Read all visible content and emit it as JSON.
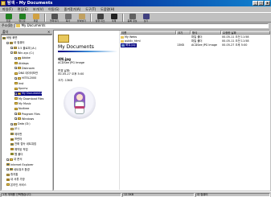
{
  "window": {
    "title": "탐색 - My Documents",
    "controls": [
      "_",
      "□",
      "x"
    ]
  },
  "menu": [
    "파일(F)",
    "편집(E)",
    "보기(V)",
    "이동(G)",
    "즐겨찾기(A)",
    "도구(T)",
    "도움말(H)"
  ],
  "toolbar": [
    {
      "label": "뒤로",
      "icon": "back-arrow-icon",
      "color": "#208020"
    },
    {
      "label": "앞으로",
      "icon": "forward-arrow-icon",
      "color": "#208020"
    },
    {
      "label": "위로",
      "icon": "up-folder-icon",
      "color": "#d0a040"
    },
    {
      "label": "잘라내기",
      "icon": "cut-icon",
      "color": "#505050"
    },
    {
      "label": "복사",
      "icon": "copy-icon",
      "color": "#707070"
    },
    {
      "label": "붙여넣기",
      "icon": "paste-icon",
      "color": "#c0a060"
    },
    {
      "label": "실행 취소",
      "icon": "undo-icon",
      "color": "#404040"
    },
    {
      "label": "삭제",
      "icon": "delete-icon",
      "color": "#202020"
    },
    {
      "label": "등록 정보",
      "icon": "properties-icon",
      "color": "#606060"
    },
    {
      "label": "보기",
      "icon": "views-icon",
      "color": "#404080"
    }
  ],
  "address": {
    "label": "주소(D)",
    "value": "My Documents"
  },
  "tree_pane": {
    "title": "폴더"
  },
  "tree": [
    {
      "label": "바탕 화면",
      "level": 0,
      "exp": "",
      "icon": "desktop"
    },
    {
      "label": "내 컴퓨터",
      "level": 1,
      "exp": "-",
      "icon": "computer"
    },
    {
      "label": "3.5 플로피 (A:)",
      "level": 2,
      "exp": "+",
      "icon": "drive"
    },
    {
      "label": "Win-sys (C:)",
      "level": 2,
      "exp": "-",
      "icon": "drive"
    },
    {
      "label": "Adobe",
      "level": 3,
      "exp": "+",
      "icon": "folder"
    },
    {
      "label": "Atidaps",
      "level": 3,
      "exp": "",
      "icon": "folder"
    },
    {
      "label": "Diskroom",
      "level": 3,
      "exp": "+",
      "icon": "folder"
    },
    {
      "label": "DNS 데이터보관",
      "level": 3,
      "exp": "",
      "icon": "folder"
    },
    {
      "label": "HITEL2000",
      "level": 3,
      "exp": "+",
      "icon": "folder"
    },
    {
      "label": "Inst",
      "level": 3,
      "exp": "",
      "icon": "folder"
    },
    {
      "label": "Kpcmv",
      "level": 3,
      "exp": "",
      "icon": "folder"
    },
    {
      "label": "My Documents",
      "level": 3,
      "exp": "+",
      "icon": "folder",
      "selected": true
    },
    {
      "label": "My Download Files",
      "level": 3,
      "exp": "",
      "icon": "folder"
    },
    {
      "label": "My Music",
      "level": 3,
      "exp": "",
      "icon": "folder"
    },
    {
      "label": "Ncdtree",
      "level": 3,
      "exp": "",
      "icon": "folder"
    },
    {
      "label": "Program Files",
      "level": 3,
      "exp": "+",
      "icon": "folder"
    },
    {
      "label": "Windows",
      "level": 3,
      "exp": "+",
      "icon": "folder"
    },
    {
      "label": "Data (D:)",
      "level": 2,
      "exp": "+",
      "icon": "drive"
    },
    {
      "label": "(E:)",
      "level": 2,
      "exp": "",
      "icon": "cdrom"
    },
    {
      "label": "제어판",
      "level": 2,
      "exp": "",
      "icon": "control"
    },
    {
      "label": "프린터",
      "level": 2,
      "exp": "",
      "icon": "printer"
    },
    {
      "label": "전화 접속 네트워킹",
      "level": 2,
      "exp": "",
      "icon": "network"
    },
    {
      "label": "예약된 작업",
      "level": 2,
      "exp": "",
      "icon": "tasks"
    },
    {
      "label": "웹 폴더",
      "level": 2,
      "exp": "",
      "icon": "web"
    },
    {
      "label": "내 문서",
      "level": 1,
      "exp": "+",
      "icon": "folder"
    },
    {
      "label": "Internet Explorer",
      "level": 1,
      "exp": "",
      "icon": "ie"
    },
    {
      "label": "네트워크 환경",
      "level": 1,
      "exp": "+",
      "icon": "network"
    },
    {
      "label": "휴지통",
      "level": 1,
      "exp": "",
      "icon": "trash"
    },
    {
      "label": "내 서류 가방",
      "level": 1,
      "exp": "",
      "icon": "briefcase"
    },
    {
      "label": "온라인 서비스",
      "level": 1,
      "exp": "",
      "icon": "folder"
    }
  ],
  "side_panel": {
    "title": "My Documents",
    "file_name": "배워.jpg",
    "file_type": "ACDSee JPG Image",
    "modified_label": "변경 날짜:",
    "modified_value": "00-05-27 오후 5:00",
    "size_label": "크기: 13KB"
  },
  "list": {
    "columns": [
      "이름",
      "크기",
      "형식",
      "수정한 날짜"
    ],
    "rows": [
      {
        "name": "My Webs",
        "size": "",
        "type": "파일 폴더",
        "modified": "00-05-11 오전 11:58",
        "icon": "folder"
      },
      {
        "name": "public_html",
        "size": "",
        "type": "파일 폴더",
        "modified": "00-05-11 오전 11:58",
        "icon": "folder"
      },
      {
        "name": "배워.jpg",
        "size": "13KB",
        "type": "ACDSee JPG Image",
        "modified": "00-05-27 오후 5:00",
        "icon": "image",
        "selected": true
      }
    ]
  },
  "status": {
    "left": "1개 개체를 선택했습니다.",
    "middle": "12.5KB",
    "right": "내 컴퓨터"
  }
}
